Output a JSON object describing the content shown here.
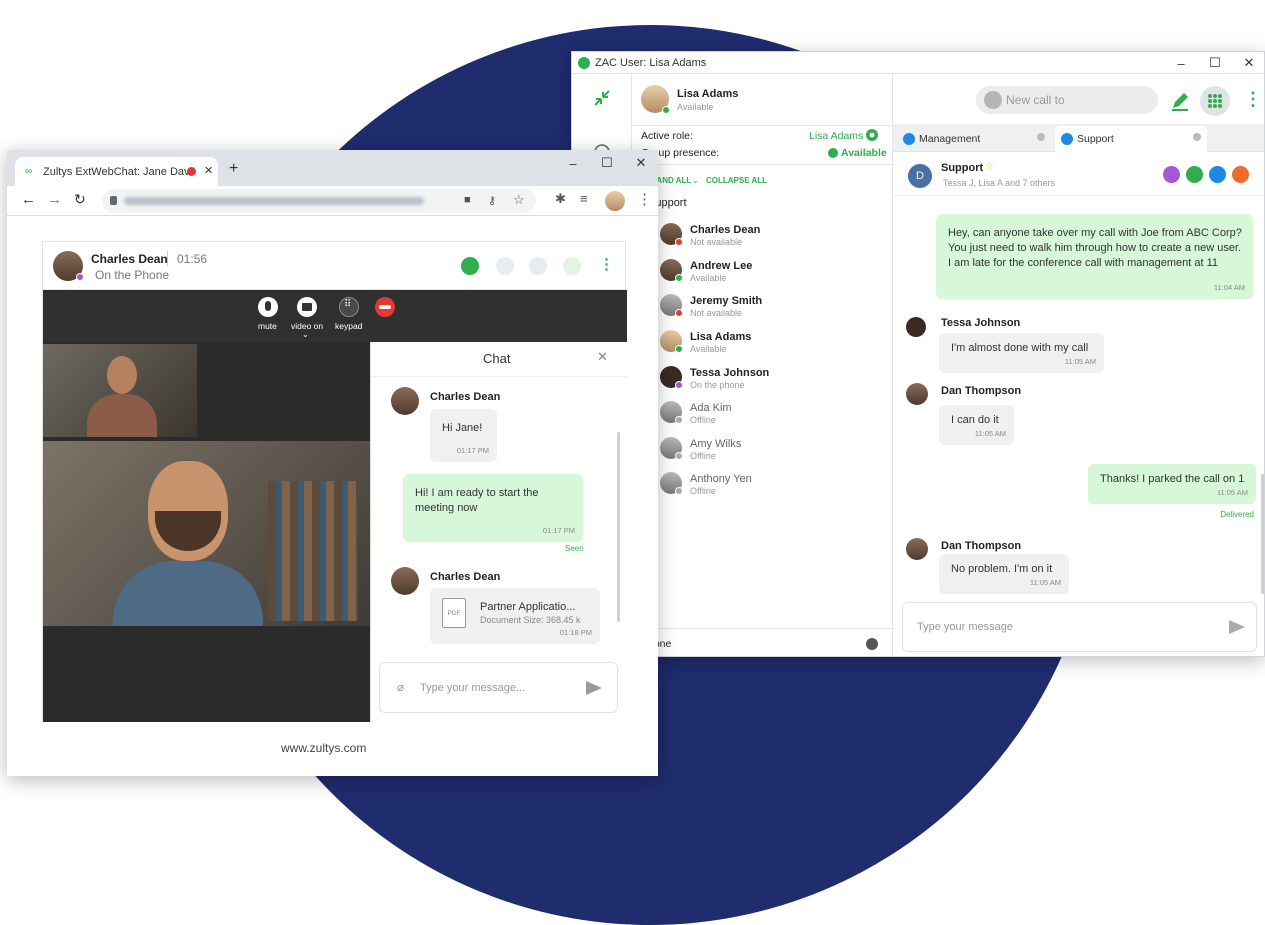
{
  "zac": {
    "window_title": "ZAC User: Lisa Adams",
    "window_controls": [
      "–",
      "☐",
      "✕"
    ],
    "user": {
      "name": "Lisa Adams",
      "status": "Available"
    },
    "active_role_label": "Active role:",
    "active_role_value": "Lisa Adams",
    "group_presence_label": "Group presence:",
    "group_presence_value": "Available",
    "expand_all": "EXPAND ALL",
    "collapse_all": "COLLAPSE ALL",
    "group_name": "Support",
    "contacts": [
      {
        "name": "Charles Dean",
        "status": "Not available"
      },
      {
        "name": "Andrew Lee",
        "status": "Available"
      },
      {
        "name": "Jeremy Smith",
        "status": "Not available"
      },
      {
        "name": "Lisa Adams",
        "status": "Available"
      },
      {
        "name": "Tessa Johnson",
        "status": "On the phone"
      },
      {
        "name": "Ada Kim",
        "status": "Offline"
      },
      {
        "name": "Amy Wilks",
        "status": "Offline"
      },
      {
        "name": "Anthony Yen",
        "status": "Offline"
      }
    ],
    "footer_label": "Phone",
    "new_call_placeholder": "New call to",
    "tabs": [
      {
        "label": "Management"
      },
      {
        "label": "Support"
      }
    ],
    "conversation": {
      "title": "Support",
      "members": "Tessa J, Lisa A and 7 others",
      "avatar_letter": "D",
      "messages": [
        {
          "text": "Hey, can anyone take over my call with Joe from ABC Corp? You just need to walk him through how to create a new user. I am late for the conference call with management at 11",
          "time": "11:04 AM"
        },
        {
          "sender": "Tessa Johnson",
          "text": "I'm almost done with my call",
          "time": "11:05 AM"
        },
        {
          "sender": "Dan Thompson",
          "text": "I can do it",
          "time": "11:05 AM"
        },
        {
          "text": "Thanks! I parked the call on 1",
          "time": "11:05 AM",
          "status": "Delivered"
        },
        {
          "sender": "Dan Thompson",
          "text": "No problem. I'm on it",
          "time": "11:05 AM"
        }
      ],
      "input_placeholder": "Type your message"
    },
    "colors": {
      "accent": "#2fae4e",
      "tab_blue": "#1e88e5",
      "out_bubble": "#d7f7d9"
    }
  },
  "browser": {
    "tab_title": "Zultys ExtWebChat: Jane Dav",
    "new_tab": "+",
    "window_controls": [
      "–",
      "☐",
      "✕"
    ],
    "call": {
      "name": "Charles Dean",
      "timer": "01:56",
      "status": "On the Phone",
      "controls": [
        "mute",
        "video on",
        "keypad"
      ]
    },
    "chat": {
      "title": "Chat",
      "close": "✕",
      "messages": [
        {
          "sender": "Charles Dean",
          "text": "Hi Jane!",
          "time": "01:17 PM"
        },
        {
          "text": "Hi! I am ready to start the meeting now",
          "time": "01:17 PM",
          "status": "Seen"
        },
        {
          "sender": "Charles Dean",
          "file_name": "Partner Applicatio...",
          "file_size": "Document Size: 368.45 k",
          "file_type": "PDF",
          "time": "01:18 PM"
        }
      ],
      "input_placeholder": "Type your message..."
    },
    "footer": "www.zultys.com"
  }
}
